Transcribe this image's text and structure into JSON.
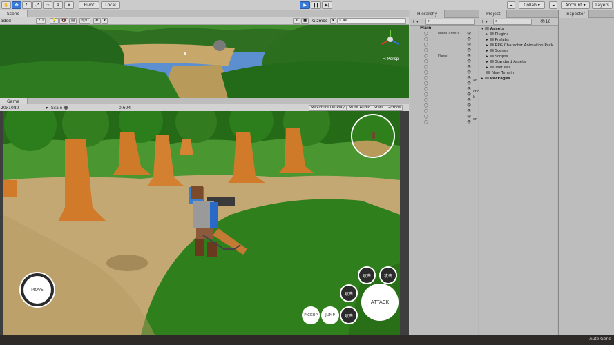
{
  "toolbar": {
    "pivot": "Pivot",
    "local": "Local",
    "collab": "Collab",
    "account": "Account",
    "layers": "Layers"
  },
  "scene": {
    "tab": "Scene",
    "shading": "aded",
    "mode2d": "2D",
    "gizmos": "Gizmos",
    "search": "All",
    "persp": "< Persp",
    "count": "0"
  },
  "game": {
    "tab": "Game",
    "resolution": "20x1080",
    "scale_label": "Scale",
    "scale_value": "0.604",
    "maximize": "Maximize On Play",
    "mute": "Mute Audio",
    "stats": "Stats",
    "gizmos": "Gizmos"
  },
  "controls": {
    "move": "MOVE",
    "attack": "ATTACK",
    "pickup": "PICKUP",
    "jump": "JUMP",
    "skill1": "攻击",
    "skill2": "攻击",
    "skill3": "攻击",
    "skill4": "攻击"
  },
  "hierarchy": {
    "tab": "Hierarchy",
    "root": "Main",
    "items": [
      "MainCamera",
      "",
      "",
      "",
      "Player",
      "",
      "",
      "",
      "",
      "",
      "",
      "",
      "",
      "",
      "",
      "",
      ""
    ],
    "right_labels": [
      "an",
      "ctio",
      "k",
      "on"
    ]
  },
  "project": {
    "tab": "Project",
    "count": "16",
    "assets_label": "Assets",
    "folders": [
      "Plugins",
      "Prefabs",
      "RPG Character Animation Pack",
      "Scenes",
      "Scripts",
      "Standard Assets",
      "Textures",
      "New Terrain"
    ],
    "packages": "Packages"
  },
  "inspector": {
    "tab": "Inspector"
  },
  "status": {
    "auto_generate": "Auto Gene"
  },
  "colors": {
    "accent": "#3a7ad8",
    "grass": "#2f7a1e",
    "trunk": "#d07a2a"
  }
}
